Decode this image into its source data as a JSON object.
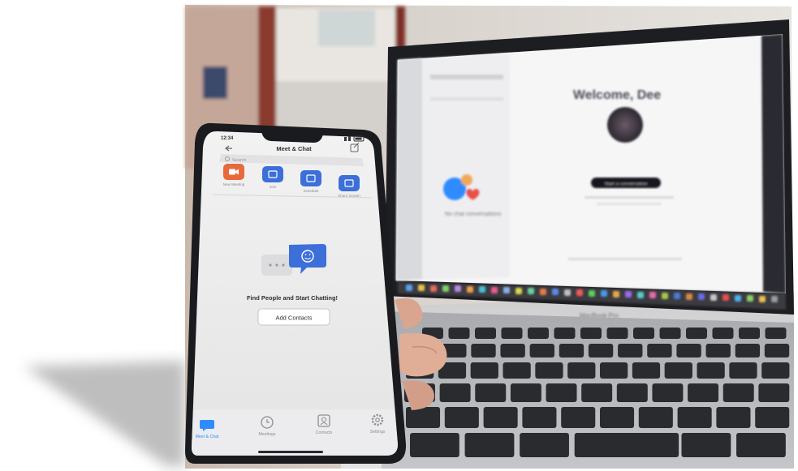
{
  "phone": {
    "status_time": "12:34",
    "header_title": "Meet & Chat",
    "search_placeholder": "Search",
    "actions": [
      {
        "label": "New Meeting",
        "color": "#e8693c"
      },
      {
        "label": "Join",
        "color": "#3d6fd9"
      },
      {
        "label": "Schedule",
        "color": "#3d6fd9"
      },
      {
        "label": "Share Screen",
        "color": "#3d6fd9"
      }
    ],
    "empty_message": "Find People and Start Chatting!",
    "add_contacts_label": "Add Contacts",
    "tabs": [
      {
        "label": "Meet & Chat",
        "icon": "chat-bubble-icon",
        "active": true
      },
      {
        "label": "Meetings",
        "icon": "clock-icon",
        "active": false
      },
      {
        "label": "Contacts",
        "icon": "person-icon",
        "active": false
      },
      {
        "label": "Settings",
        "icon": "gear-icon",
        "active": false
      }
    ]
  },
  "laptop": {
    "welcome_text": "Welcome, Dee",
    "primary_button_label": "Start a conversation",
    "sidebar_caption": "No chat conversations",
    "brand": "MacBook Pro"
  },
  "colors": {
    "accent_blue": "#2d8cff",
    "zoom_orange": "#e8693c",
    "heart_red": "#e8504a"
  }
}
